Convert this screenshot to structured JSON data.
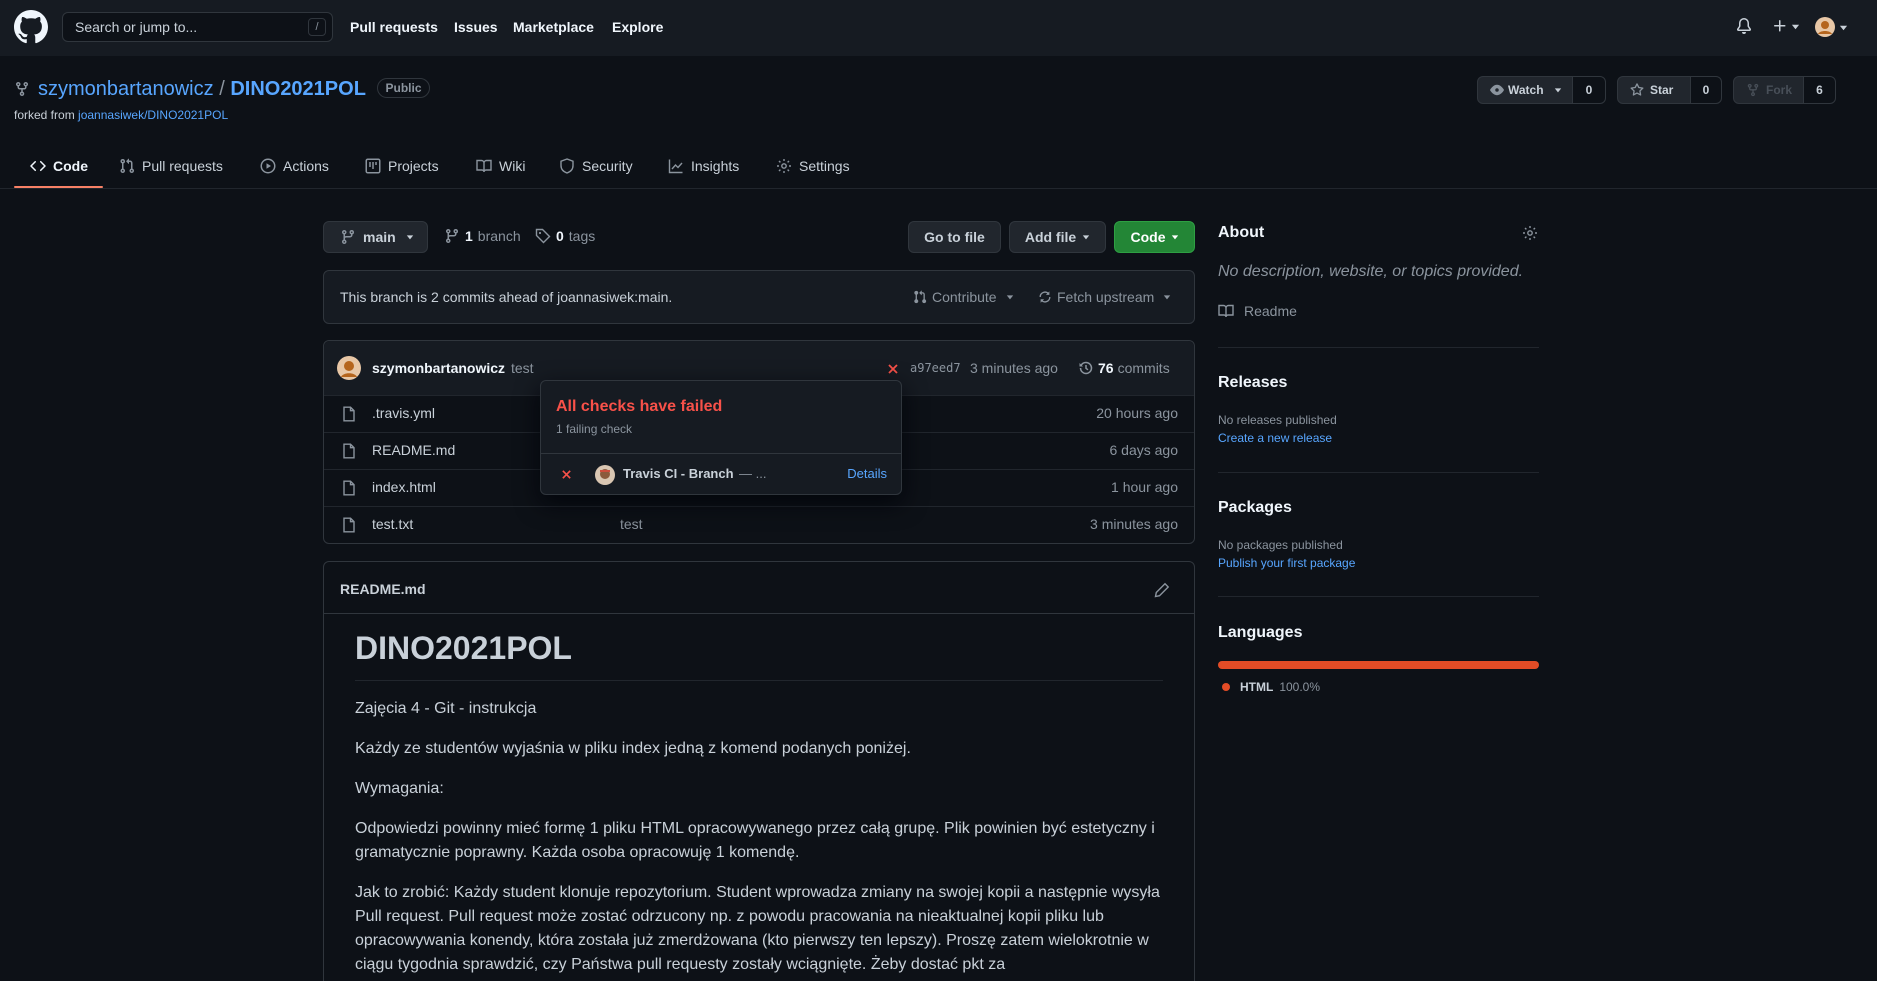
{
  "header": {
    "search_placeholder": "Search or jump to...",
    "slash_key": "/",
    "nav": [
      "Pull requests",
      "Issues",
      "Marketplace",
      "Explore"
    ]
  },
  "repo": {
    "owner": "szymonbartanowicz",
    "separator": "/",
    "name": "DINO2021POL",
    "visibility": "Public",
    "forked_prefix": "forked from",
    "forked_from": "joannasiwek/DINO2021POL",
    "watch_label": "Watch",
    "watch_count": "0",
    "star_label": "Star",
    "star_count": "0",
    "fork_label": "Fork",
    "fork_count": "6"
  },
  "tabs": [
    {
      "label": "Code",
      "icon": "code-icon"
    },
    {
      "label": "Pull requests",
      "icon": "pull-request-icon"
    },
    {
      "label": "Actions",
      "icon": "play-icon"
    },
    {
      "label": "Projects",
      "icon": "project-icon"
    },
    {
      "label": "Wiki",
      "icon": "book-icon"
    },
    {
      "label": "Security",
      "icon": "shield-icon"
    },
    {
      "label": "Insights",
      "icon": "graph-icon"
    },
    {
      "label": "Settings",
      "icon": "gear-icon"
    }
  ],
  "toolbar": {
    "branch": "main",
    "branch_count": "1",
    "branch_word": "branch",
    "tag_count": "0",
    "tag_word": "tags",
    "go_to_file": "Go to file",
    "add_file": "Add file",
    "code": "Code"
  },
  "ahead": {
    "message": "This branch is 2 commits ahead of joannasiwek:main.",
    "contribute": "Contribute",
    "fetch_upstream": "Fetch upstream"
  },
  "commit": {
    "author": "szymonbartanowicz",
    "message": "test",
    "sha": "a97eed7",
    "time": "3 minutes ago",
    "count": "76",
    "count_word": "commits"
  },
  "files": [
    {
      "name": ".travis.yml",
      "message": "",
      "time": "20 hours ago"
    },
    {
      "name": "README.md",
      "message": "",
      "time": "6 days ago"
    },
    {
      "name": "index.html",
      "message": "",
      "time": "1 hour ago"
    },
    {
      "name": "test.txt",
      "message": "test",
      "time": "3 minutes ago"
    }
  ],
  "popover": {
    "title": "All checks have failed",
    "subtitle": "1 failing check",
    "check_name": "Travis CI - Branch",
    "check_suffix": "— ...",
    "details": "Details"
  },
  "readme": {
    "filename": "README.md",
    "title": "DINO2021POL",
    "paragraphs": [
      "Zajęcia 4 - Git - instrukcja",
      "Każdy ze studentów wyjaśnia w pliku index jedną z komend podanych poniżej.",
      "Wymagania:",
      "Odpowiedzi powinny mieć formę 1 pliku HTML opracowywanego przez całą grupę. Plik powinien być estetyczny i gramatycznie poprawny. Każda osoba opracowuję 1 komendę.",
      "Jak to zrobić: Każdy student klonuje repozytorium. Student wprowadza zmiany na swojej kopii a następnie wysyła Pull request. Pull request może zostać odrzucony np. z powodu pracowania na nieaktualnej kopii pliku lub opracowywania konendy, która została już zmerdżowana (kto pierwszy ten lepszy). Proszę zatem wielokrotnie w ciągu tygodnia sprawdzić, czy Państwa pull requesty zostały wciągnięte. Żeby dostać pkt za"
    ]
  },
  "sidebar": {
    "about_title": "About",
    "about_text": "No description, website, or topics provided.",
    "readme_link": "Readme",
    "releases_title": "Releases",
    "releases_text": "No releases published",
    "releases_link": "Create a new release",
    "packages_title": "Packages",
    "packages_text": "No packages published",
    "packages_link": "Publish your first package",
    "languages_title": "Languages",
    "language_name": "HTML",
    "language_percent": "100.0%",
    "language_fraction": 1.0
  },
  "colors": {
    "accent_link": "#58a6ff",
    "success_button": "#238636",
    "danger": "#f85149",
    "html_language": "#e34c26",
    "tab_underline": "#f78166"
  }
}
